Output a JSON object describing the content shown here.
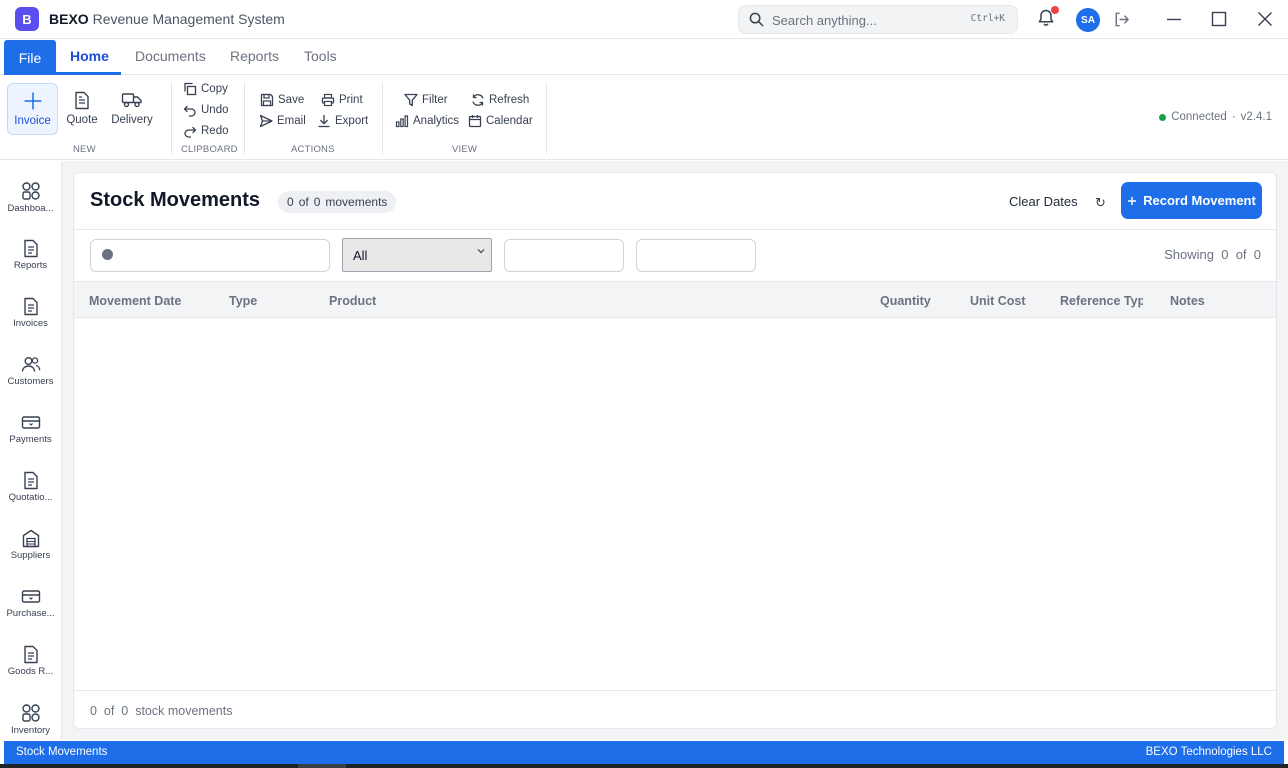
{
  "app": {
    "logo_letter": "B",
    "brand_bold": "BEXO",
    "brand_rest": "Revenue Management System",
    "search_placeholder": "Search anything...",
    "search_shortcut": "Ctrl+K",
    "avatar_initials": "SA",
    "accent_color": "#1d6ee8",
    "icons": [
      "search-icon",
      "bell-icon",
      "logout-icon",
      "minimize-icon",
      "maximize-icon",
      "close-icon"
    ]
  },
  "menu": {
    "file": "File",
    "tabs": [
      {
        "label": "Home",
        "active": true
      },
      {
        "label": "Documents"
      },
      {
        "label": "Reports"
      },
      {
        "label": "Tools"
      }
    ]
  },
  "ribbon": {
    "new_group": {
      "label": "NEW",
      "items": [
        {
          "label": "Invoice",
          "icon": "plus-icon",
          "selected": true
        },
        {
          "label": "Quote",
          "icon": "document-icon"
        },
        {
          "label": "Delivery",
          "icon": "truck-icon"
        }
      ]
    },
    "clipboard_group": {
      "label": "CLIPBOARD",
      "items": [
        {
          "label": "Copy",
          "icon": "copy-icon"
        },
        {
          "label": "Undo",
          "icon": "undo-icon"
        },
        {
          "label": "Redo",
          "icon": "redo-icon"
        }
      ]
    },
    "actions_group": {
      "label": "ACTIONS",
      "items": [
        {
          "label": "Save",
          "icon": "save-icon"
        },
        {
          "label": "Print",
          "icon": "print-icon"
        },
        {
          "label": "Email",
          "icon": "send-icon"
        },
        {
          "label": "Export",
          "icon": "download-icon"
        }
      ]
    },
    "view_group": {
      "label": "VIEW",
      "items": [
        {
          "label": "Filter",
          "icon": "filter-icon"
        },
        {
          "label": "Refresh",
          "icon": "refresh-icon"
        },
        {
          "label": "Analytics",
          "icon": "bar-chart-icon"
        },
        {
          "label": "Calendar",
          "icon": "calendar-icon"
        }
      ]
    },
    "status": {
      "connection": "Connected",
      "separator": "·",
      "version": "v2.4.1",
      "status_color": "#16a34a"
    }
  },
  "sidebar": {
    "items": [
      {
        "label": "Dashboa...",
        "icon": "grid-icon"
      },
      {
        "label": "Reports",
        "icon": "document-icon"
      },
      {
        "label": "Invoices",
        "icon": "document-icon"
      },
      {
        "label": "Customers",
        "icon": "users-icon"
      },
      {
        "label": "Payments",
        "icon": "card-icon"
      },
      {
        "label": "Quotatio...",
        "icon": "document-icon"
      },
      {
        "label": "Suppliers",
        "icon": "warehouse-icon"
      },
      {
        "label": "Purchase...",
        "icon": "card-icon"
      },
      {
        "label": "Goods R...",
        "icon": "document-icon"
      },
      {
        "label": "Inventory",
        "icon": "grid-icon"
      }
    ]
  },
  "page": {
    "title": "Stock Movements",
    "count_shown": "0",
    "count_of": "of",
    "count_total": "0",
    "count_unit": "movements",
    "clear_dates": "Clear Dates",
    "refresh_glyph": "↻",
    "record_button": "Record Movement",
    "filters": {
      "search_value": "",
      "type_selected": "All",
      "date_from": "",
      "date_to": ""
    },
    "showing": {
      "label": "Showing",
      "shown": "0",
      "of": "of",
      "total": "0"
    },
    "columns": [
      "Movement Date",
      "Type",
      "Product",
      "Quantity",
      "Unit Cost",
      "Reference Type",
      "Notes"
    ],
    "rows": [],
    "footer": {
      "shown": "0",
      "of": "of",
      "total": "0",
      "unit": "stock movements"
    }
  },
  "statusbar": {
    "left": "Stock Movements",
    "right": "BEXO Technologies LLC"
  }
}
